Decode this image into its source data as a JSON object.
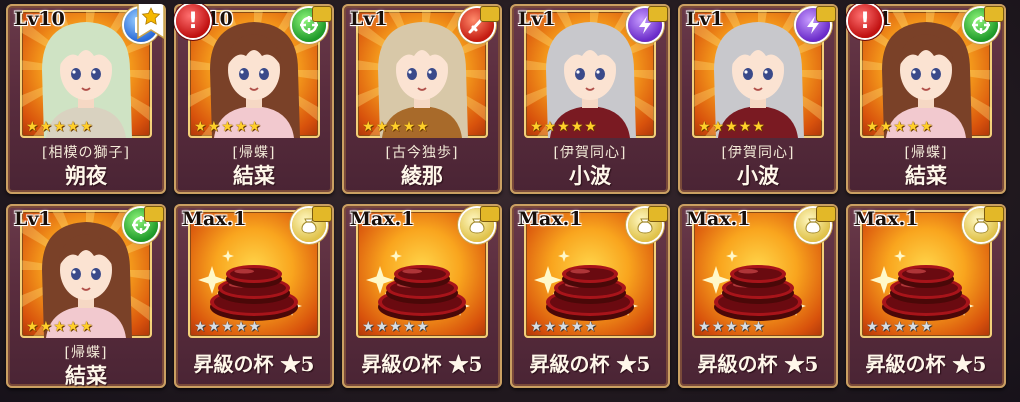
{
  "cards": [
    {
      "kind": "character",
      "level": "Lv10",
      "attribute": "blue",
      "attribute_icon": "book-icon",
      "stars": 5,
      "title": "[相模の獅子]",
      "name": "朔夜",
      "favorite": true,
      "warning": false,
      "hair": "#cfe3c4",
      "outfit": "#d9d2c0"
    },
    {
      "kind": "character",
      "level": "Lv10",
      "attribute": "green",
      "attribute_icon": "target-icon",
      "stars": 5,
      "title": "[帰蝶]",
      "name": "結菜",
      "favorite": false,
      "warning": true,
      "hair": "#7a4128",
      "outfit": "#f2c9cf"
    },
    {
      "kind": "character",
      "level": "Lv1",
      "attribute": "red",
      "attribute_icon": "sword-icon",
      "stars": 5,
      "title": "[古今独歩]",
      "name": "綾那",
      "favorite": false,
      "warning": false,
      "hair": "#d8c8a8",
      "outfit": "#a86a2a"
    },
    {
      "kind": "character",
      "level": "Lv1",
      "attribute": "purple",
      "attribute_icon": "lightning-icon",
      "stars": 5,
      "title": "[伊賀同心]",
      "name": "小波",
      "favorite": false,
      "warning": false,
      "hair": "#c8c8cc",
      "outfit": "#7a1a22"
    },
    {
      "kind": "character",
      "level": "Lv1",
      "attribute": "purple",
      "attribute_icon": "lightning-icon",
      "stars": 5,
      "title": "[伊賀同心]",
      "name": "小波",
      "favorite": false,
      "warning": false,
      "hair": "#c8c8cc",
      "outfit": "#7a1a22"
    },
    {
      "kind": "character",
      "level": "Lv1",
      "attribute": "green",
      "attribute_icon": "target-icon",
      "stars": 5,
      "title": "[帰蝶]",
      "name": "結菜",
      "favorite": false,
      "warning": true,
      "hair": "#7a4128",
      "outfit": "#f2c9cf"
    },
    {
      "kind": "character",
      "level": "Lv1",
      "attribute": "green",
      "attribute_icon": "target-icon",
      "stars": 5,
      "title": "[帰蝶]",
      "name": "結菜",
      "favorite": false,
      "warning": false,
      "hair": "#7a4128",
      "outfit": "#f2c9cf"
    },
    {
      "kind": "item",
      "level": "Max.1",
      "attribute": "gold",
      "attribute_icon": "pouch-icon",
      "stars": 5,
      "name": "昇級の杯 ★5"
    },
    {
      "kind": "item",
      "level": "Max.1",
      "attribute": "gold",
      "attribute_icon": "pouch-icon",
      "stars": 5,
      "name": "昇級の杯 ★5"
    },
    {
      "kind": "item",
      "level": "Max.1",
      "attribute": "gold",
      "attribute_icon": "pouch-icon",
      "stars": 5,
      "name": "昇級の杯 ★5"
    },
    {
      "kind": "item",
      "level": "Max.1",
      "attribute": "gold",
      "attribute_icon": "pouch-icon",
      "stars": 5,
      "name": "昇級の杯 ★5"
    },
    {
      "kind": "item",
      "level": "Max.1",
      "attribute": "gold",
      "attribute_icon": "pouch-icon",
      "stars": 5,
      "name": "昇級の杯 ★5"
    }
  ],
  "warning_glyph": "!",
  "star_glyph": "★"
}
